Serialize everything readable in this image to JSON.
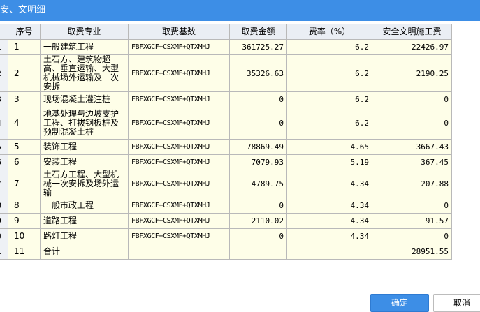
{
  "window": {
    "title": "安、文明细"
  },
  "table": {
    "headers": [
      "序号",
      "取费专业",
      "取费基数",
      "取费金额",
      "费率（%）",
      "安全文明施工费"
    ],
    "rows": [
      {
        "row_no": "1",
        "seq": "1",
        "name": "一般建筑工程",
        "basis": "FBFXGCF+CSXMF+QTXMHJ",
        "amount": "361725.27",
        "rate": "6.2",
        "fee": "22426.97"
      },
      {
        "row_no": "2",
        "seq": "2",
        "name": "土石方、建筑物超高、垂直运输、大型机械场外运输及一次安拆",
        "basis": "FBFXGCF+CSXMF+QTXMHJ",
        "amount": "35326.63",
        "rate": "6.2",
        "fee": "2190.25"
      },
      {
        "row_no": "3",
        "seq": "3",
        "name": "现场混凝土灌注桩",
        "basis": "FBFXGCF+CSXMF+QTXMHJ",
        "amount": "0",
        "rate": "6.2",
        "fee": "0"
      },
      {
        "row_no": "4",
        "seq": "4",
        "name": "地基处理与边坡支护工程、打拔钢板桩及预制混凝土桩",
        "basis": "FBFXGCF+CSXMF+QTXMHJ",
        "amount": "0",
        "rate": "6.2",
        "fee": "0"
      },
      {
        "row_no": "5",
        "seq": "5",
        "name": "装饰工程",
        "basis": "FBFXGCF+CSXMF+QTXMHJ",
        "amount": "78869.49",
        "rate": "4.65",
        "fee": "3667.43"
      },
      {
        "row_no": "6",
        "seq": "6",
        "name": "安装工程",
        "basis": "FBFXGCF+CSXMF+QTXMHJ",
        "amount": "7079.93",
        "rate": "5.19",
        "fee": "367.45"
      },
      {
        "row_no": "7",
        "seq": "7",
        "name": "土石方工程、大型机械一次安拆及场外运输",
        "basis": "FBFXGCF+CSXMF+QTXMHJ",
        "amount": "4789.75",
        "rate": "4.34",
        "fee": "207.88"
      },
      {
        "row_no": "8",
        "seq": "8",
        "name": "一般市政工程",
        "basis": "FBFXGCF+CSXMF+QTXMHJ",
        "amount": "0",
        "rate": "4.34",
        "fee": "0"
      },
      {
        "row_no": "9",
        "seq": "9",
        "name": "道路工程",
        "basis": "FBFXGCF+CSXMF+QTXMHJ",
        "amount": "2110.02",
        "rate": "4.34",
        "fee": "91.57"
      },
      {
        "row_no": "0",
        "seq": "10",
        "name": "路灯工程",
        "basis": "FBFXGCF+CSXMF+QTXMHJ",
        "amount": "0",
        "rate": "4.34",
        "fee": "0"
      },
      {
        "row_no": "1",
        "seq": "11",
        "name": "合计",
        "basis": "",
        "amount": "",
        "rate": "",
        "fee": "28951.55"
      }
    ]
  },
  "buttons": {
    "ok": "确定",
    "cancel": "取消"
  },
  "colors": {
    "titlebar": "#3d8ee6",
    "cell_bg": "#fefee8",
    "header_bg": "#eaeef4",
    "ok_button": "#3d8ee6"
  }
}
